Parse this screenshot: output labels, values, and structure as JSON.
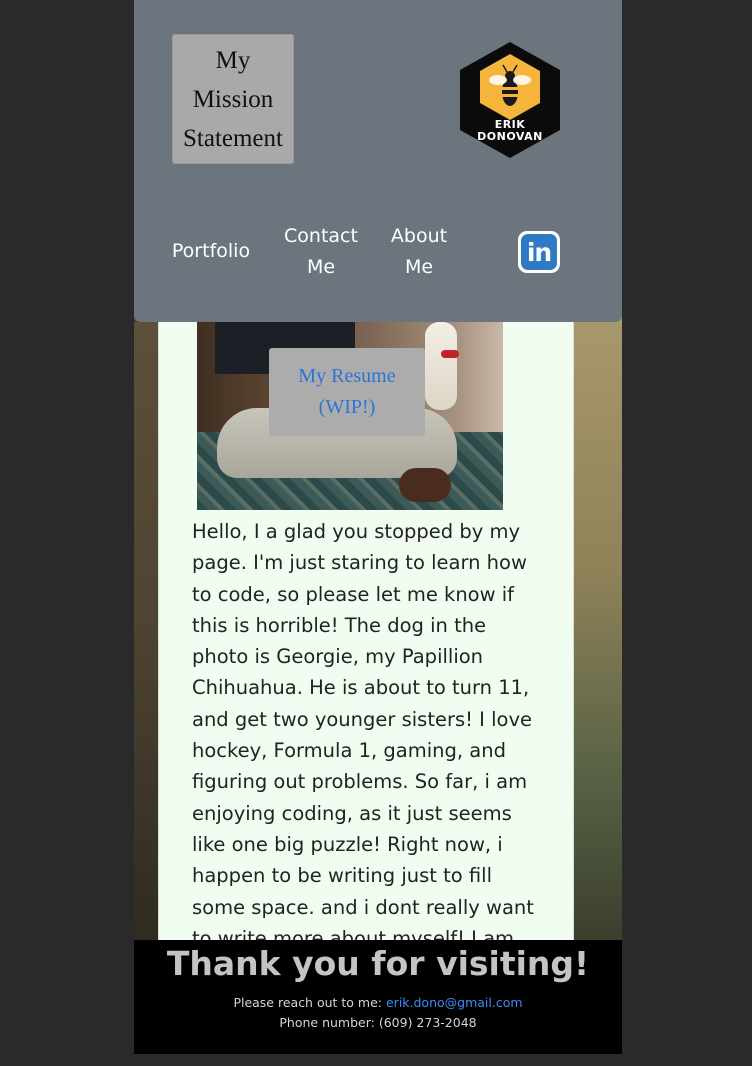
{
  "header": {
    "mission_button": "My Mission Statement",
    "logo_text_line1": "ERIK",
    "logo_text_line2": "DONOVAN",
    "nav": {
      "portfolio": "Portfolio",
      "contact": "Contact Me",
      "about": "About Me"
    },
    "linkedin_icon_text": "in"
  },
  "main": {
    "resume_button": "My Resume (WIP!)",
    "about_text": "Hello, I a glad you stopped by my page. I'm just staring to learn how to code, so please let me know if this is horrible! The dog in the photo is Georgie, my Papillion Chihuahua. He is about to turn 11, and get two younger sisters! I love hockey, Formula 1, gaming, and figuring out problems. So far, i am enjoying coding, as it just seems like one big puzzle! Right now, i happen to be writing just to fill some space. and i dont really want to write more about myself! I am glad that we are not"
  },
  "footer": {
    "title": "Thank you for visiting!",
    "reach_label": "Please reach out to me: ",
    "email": "erik.dono@gmail.com",
    "phone": "Phone number: (609) 273-2048"
  },
  "colors": {
    "header_bg": "#6c757d",
    "card_bg": "#f2fdf1",
    "link_blue": "#2c74d6",
    "linkedin_blue": "#2e7bc4",
    "logo_yellow": "#f5b43c"
  }
}
